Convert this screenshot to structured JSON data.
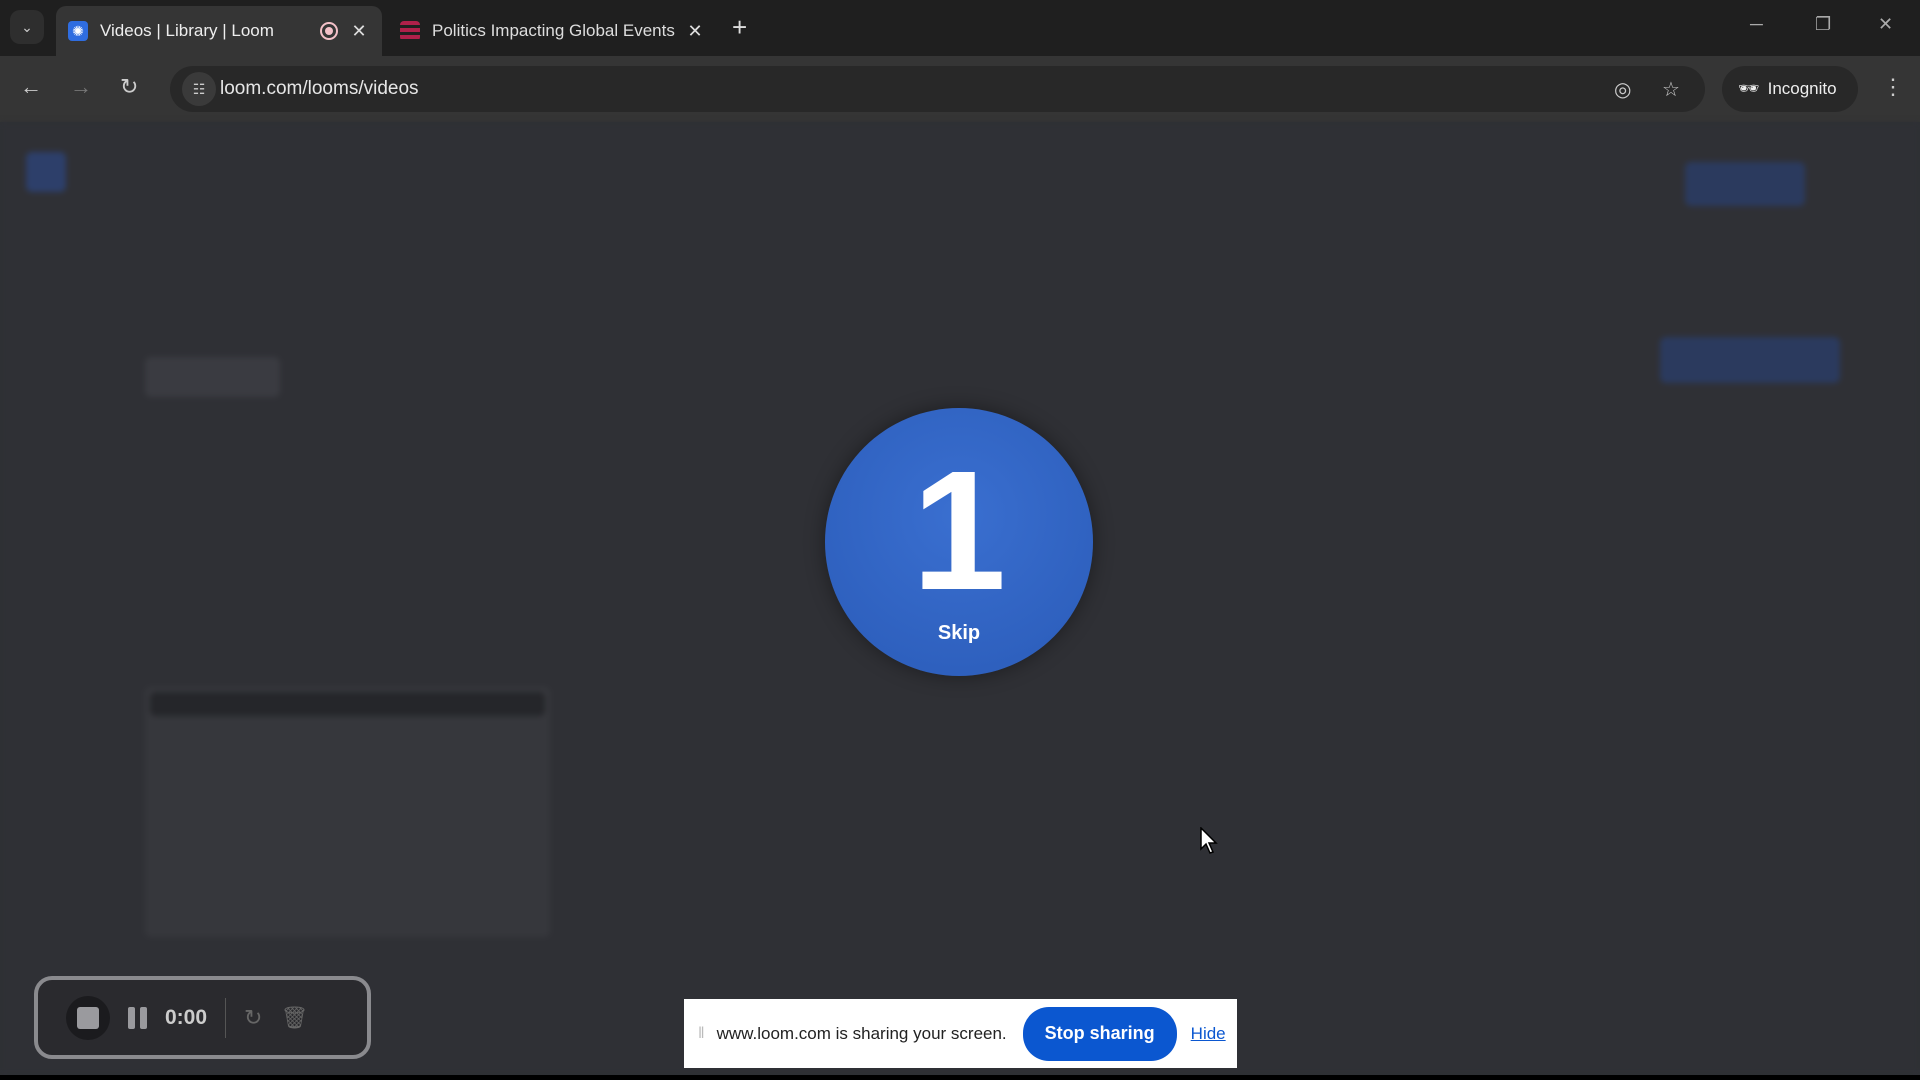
{
  "browser": {
    "tabs": [
      {
        "title": "Videos | Library | Loom",
        "recording": true
      },
      {
        "title": "Politics Impacting Global Events"
      }
    ],
    "url": "loom.com/looms/videos",
    "profile_label": "Incognito"
  },
  "countdown": {
    "number": "1",
    "skip_label": "Skip",
    "color": "#2f63c4"
  },
  "recorder": {
    "time": "0:00"
  },
  "share_banner": {
    "message": "www.loom.com is sharing your screen.",
    "stop_label": "Stop sharing",
    "hide_label": "Hide",
    "accent": "#0b57d0"
  }
}
